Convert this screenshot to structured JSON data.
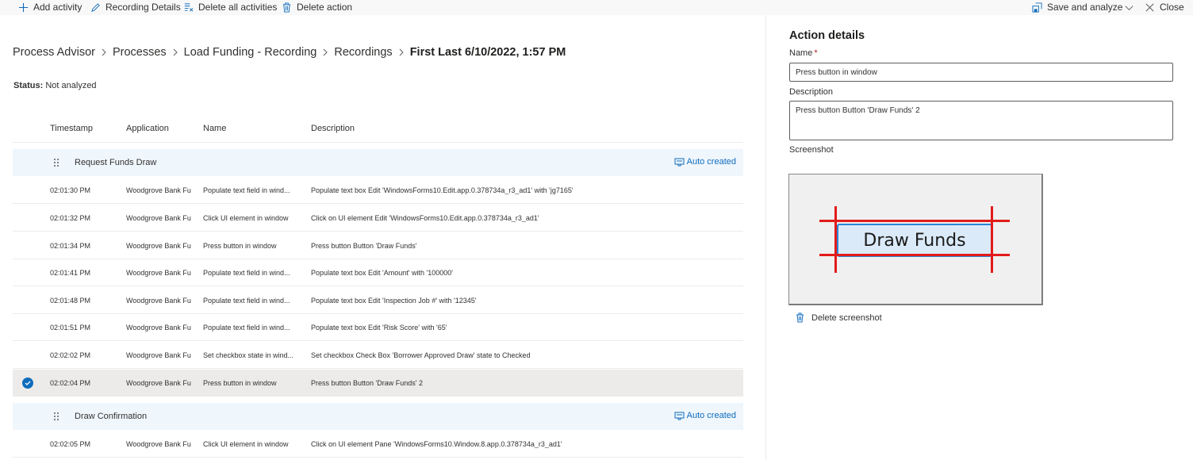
{
  "toolbar": {
    "add_activity": "Add activity",
    "recording_details": "Recording Details",
    "delete_all": "Delete all activities",
    "delete_action": "Delete action",
    "save_analyze": "Save and analyze",
    "close": "Close"
  },
  "breadcrumb": {
    "items": [
      "Process Advisor",
      "Processes",
      "Load Funding - Recording",
      "Recordings"
    ],
    "current": "First Last 6/10/2022, 1:57 PM"
  },
  "status": {
    "label": "Status:",
    "value": "Not analyzed"
  },
  "table": {
    "headers": {
      "timestamp": "Timestamp",
      "application": "Application",
      "name": "Name",
      "description": "Description"
    },
    "groups": [
      {
        "name": "Request Funds Draw",
        "badge": "Auto created",
        "rows": [
          {
            "ts": "02:01:30 PM",
            "app": "Woodgrove Bank Fu",
            "name": "Populate text field in wind...",
            "desc": "Populate text box Edit 'WindowsForms10.Edit.app.0.378734a_r3_ad1' with 'jg7165'"
          },
          {
            "ts": "02:01:32 PM",
            "app": "Woodgrove Bank Fu",
            "name": "Click UI element in window",
            "desc": "Click on UI element Edit 'WindowsForms10.Edit.app.0.378734a_r3_ad1'"
          },
          {
            "ts": "02:01:34 PM",
            "app": "Woodgrove Bank Fu",
            "name": "Press button in window",
            "desc": "Press button Button 'Draw Funds'"
          },
          {
            "ts": "02:01:41 PM",
            "app": "Woodgrove Bank Fu",
            "name": "Populate text field in wind...",
            "desc": "Populate text box Edit 'Amount' with '100000'"
          },
          {
            "ts": "02:01:48 PM",
            "app": "Woodgrove Bank Fu",
            "name": "Populate text field in wind...",
            "desc": "Populate text box Edit 'Inspection Job #' with '12345'"
          },
          {
            "ts": "02:01:51 PM",
            "app": "Woodgrove Bank Fu",
            "name": "Populate text field in wind...",
            "desc": "Populate text box Edit 'Risk Score' with '65'"
          },
          {
            "ts": "02:02:02 PM",
            "app": "Woodgrove Bank Fu",
            "name": "Set checkbox state in wind...",
            "desc": "Set checkbox Check Box 'Borrower Approved Draw' state to Checked"
          },
          {
            "ts": "02:02:04 PM",
            "app": "Woodgrove Bank Fu",
            "name": "Press button in window",
            "desc": "Press button Button 'Draw Funds' 2",
            "selected": true
          }
        ]
      },
      {
        "name": "Draw Confirmation",
        "badge": "Auto created",
        "rows": [
          {
            "ts": "02:02:05 PM",
            "app": "Woodgrove Bank Fu",
            "name": "Click UI element in window",
            "desc": "Click on UI element Pane 'WindowsForms10.Window.8.app.0.378734a_r3_ad1'"
          }
        ]
      }
    ]
  },
  "panel": {
    "title": "Action details",
    "name_label": "Name",
    "required_mark": "*",
    "name_value": "Press button in window",
    "description_label": "Description",
    "description_value": "Press button Button 'Draw Funds' 2",
    "screenshot_label": "Screenshot",
    "screenshot_button_text": "Draw Funds",
    "delete_screenshot": "Delete screenshot"
  },
  "colors": {
    "accent": "#0f6cbd",
    "group_bg": "#eff6fc",
    "selected_bg": "#edebe9",
    "highlight_red": "#e21b1b"
  }
}
